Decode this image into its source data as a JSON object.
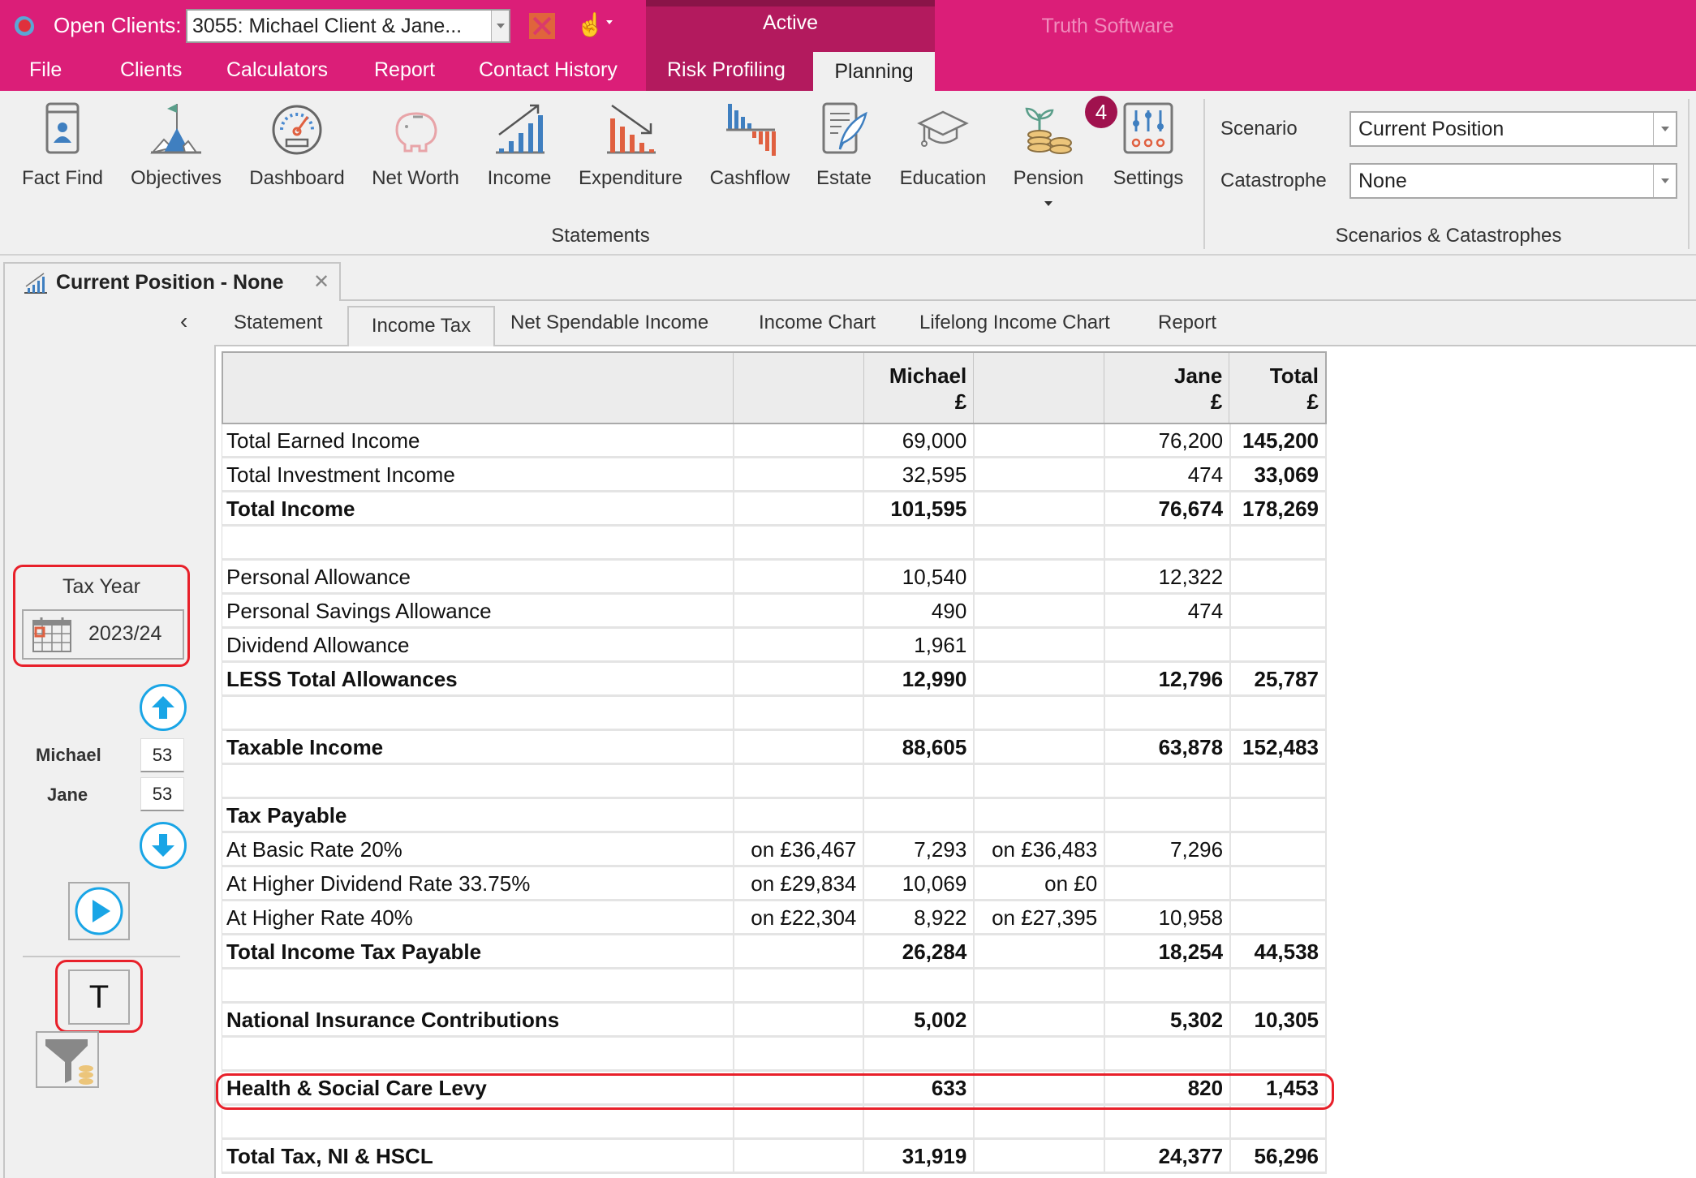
{
  "titlebar": {
    "open_clients_label": "Open Clients:",
    "client_selected": "3055: Michael Client & Jane...",
    "active_label": "Active",
    "brand": "Truth Software"
  },
  "menu": {
    "items": [
      "File",
      "Clients",
      "Calculators",
      "Report",
      "Contact History",
      "Risk Profiling",
      "Planning"
    ],
    "active": "Planning"
  },
  "ribbon": {
    "buttons": [
      {
        "label": "Fact Find",
        "icon": "fact-find-icon"
      },
      {
        "label": "Objectives",
        "icon": "objectives-icon"
      },
      {
        "label": "Dashboard",
        "icon": "dashboard-icon"
      },
      {
        "label": "Net Worth",
        "icon": "piggy-bank-icon"
      },
      {
        "label": "Income",
        "icon": "income-chart-icon"
      },
      {
        "label": "Expenditure",
        "icon": "expenditure-chart-icon"
      },
      {
        "label": "Cashflow",
        "icon": "cashflow-chart-icon"
      },
      {
        "label": "Estate",
        "icon": "estate-document-icon"
      },
      {
        "label": "Education",
        "icon": "graduation-cap-icon"
      },
      {
        "label": "Pension",
        "icon": "pension-coins-icon",
        "badge": "4"
      },
      {
        "label": "Settings",
        "icon": "settings-sliders-icon"
      }
    ],
    "statements_group_label": "Statements",
    "scenario_label": "Scenario",
    "scenario_value": "Current Position",
    "catastrophe_label": "Catastrophe",
    "catastrophe_value": "None",
    "scenarios_group_label": "Scenarios & Catastrophes"
  },
  "document": {
    "tab_title": "Current Position - None",
    "close_glyph": "✕",
    "subtabs": [
      "Statement",
      "Income Tax",
      "Net Spendable Income",
      "Income Chart",
      "Lifelong Income Chart",
      "Report"
    ],
    "active_subtab": "Income Tax"
  },
  "left_panel": {
    "collapse_glyph": "‹",
    "tax_year_label": "Tax Year",
    "tax_year_value": "2023/24",
    "people": [
      {
        "name": "Michael",
        "age": "53"
      },
      {
        "name": "Jane",
        "age": "53"
      }
    ],
    "t_button_label": "T"
  },
  "table": {
    "headers": [
      "",
      "",
      "Michael\n£",
      "",
      "Jane\n£",
      "Total\n£"
    ],
    "header_lines": [
      {
        "line1": "Michael",
        "line2": "£"
      },
      {
        "line1": "Jane",
        "line2": "£"
      },
      {
        "line1": "Total",
        "line2": "£"
      }
    ],
    "rows": [
      {
        "label": "Total Earned Income",
        "m_basis": "",
        "michael": "69,000",
        "j_basis": "",
        "jane": "76,200",
        "total": "145,200",
        "bold": false
      },
      {
        "label": "Total Investment Income",
        "m_basis": "",
        "michael": "32,595",
        "j_basis": "",
        "jane": "474",
        "total": "33,069",
        "bold": false
      },
      {
        "label": "Total Income",
        "m_basis": "",
        "michael": "101,595",
        "j_basis": "",
        "jane": "76,674",
        "total": "178,269",
        "bold": true
      },
      {
        "blank": true
      },
      {
        "label": "Personal Allowance",
        "m_basis": "",
        "michael": "10,540",
        "j_basis": "",
        "jane": "12,322",
        "total": "",
        "bold": false
      },
      {
        "label": "Personal Savings Allowance",
        "m_basis": "",
        "michael": "490",
        "j_basis": "",
        "jane": "474",
        "total": "",
        "bold": false
      },
      {
        "label": "Dividend Allowance",
        "m_basis": "",
        "michael": "1,961",
        "j_basis": "",
        "jane": "",
        "total": "",
        "bold": false
      },
      {
        "label": "LESS Total Allowances",
        "m_basis": "",
        "michael": "12,990",
        "j_basis": "",
        "jane": "12,796",
        "total": "25,787",
        "bold": true
      },
      {
        "blank": true
      },
      {
        "label": "Taxable Income",
        "m_basis": "",
        "michael": "88,605",
        "j_basis": "",
        "jane": "63,878",
        "total": "152,483",
        "bold": true
      },
      {
        "blank": true
      },
      {
        "label": "Tax Payable",
        "m_basis": "",
        "michael": "",
        "j_basis": "",
        "jane": "",
        "total": "",
        "bold": true
      },
      {
        "label": "At Basic Rate 20%",
        "m_basis": "on £36,467",
        "michael": "7,293",
        "j_basis": "on £36,483",
        "jane": "7,296",
        "total": "",
        "bold": false
      },
      {
        "label": "At Higher Dividend Rate 33.75%",
        "m_basis": "on £29,834",
        "michael": "10,069",
        "j_basis": "on £0",
        "jane": "",
        "total": "",
        "bold": false
      },
      {
        "label": "At Higher Rate 40%",
        "m_basis": "on £22,304",
        "michael": "8,922",
        "j_basis": "on £27,395",
        "jane": "10,958",
        "total": "",
        "bold": false
      },
      {
        "label": "Total Income Tax Payable",
        "m_basis": "",
        "michael": "26,284",
        "j_basis": "",
        "jane": "18,254",
        "total": "44,538",
        "bold": true
      },
      {
        "blank": true
      },
      {
        "label": "National Insurance Contributions",
        "m_basis": "",
        "michael": "5,002",
        "j_basis": "",
        "jane": "5,302",
        "total": "10,305",
        "bold": true
      },
      {
        "blank": true
      },
      {
        "label": "Health & Social Care Levy",
        "m_basis": "",
        "michael": "633",
        "j_basis": "",
        "jane": "820",
        "total": "1,453",
        "bold": true,
        "highlighted": true
      },
      {
        "blank": true
      },
      {
        "label": "Total Tax, NI & HSCL",
        "m_basis": "",
        "michael": "31,919",
        "j_basis": "",
        "jane": "24,377",
        "total": "56,296",
        "bold": true
      }
    ]
  },
  "colors": {
    "brand_pink": "#db1e78",
    "active_block": "#b31a5e",
    "highlight_red": "#e8202a",
    "accent_blue": "#19a5e6",
    "badge": "#a0124e"
  }
}
